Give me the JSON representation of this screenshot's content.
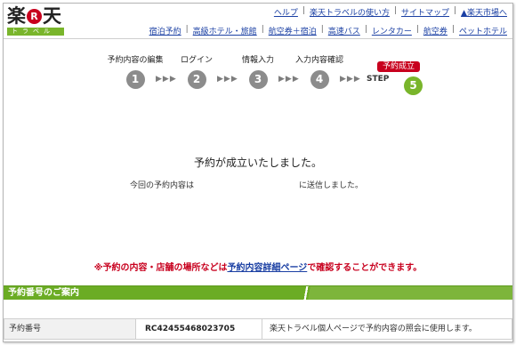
{
  "header": {
    "logo_kanji_left": "楽",
    "logo_r": "R",
    "logo_kanji_right": "天",
    "logo_sub": "トラベル",
    "top_links": [
      "ヘルプ",
      "楽天トラベルの使い方",
      "サイトマップ",
      "▲楽天市場へ"
    ],
    "nav_links": [
      "宿泊予約",
      "高級ホテル・旅館",
      "航空券＋宿泊",
      "高速バス",
      "レンタカー",
      "航空券",
      "ペットホテル"
    ]
  },
  "steps": {
    "items": [
      {
        "label": "予約内容の編集",
        "number": "1"
      },
      {
        "label": "ログイン",
        "number": "2"
      },
      {
        "label": "情報入力",
        "number": "3"
      },
      {
        "label": "入力内容確認",
        "number": "4"
      },
      {
        "label": "予約成立",
        "number": "5"
      }
    ],
    "step_word": "STEP",
    "arrow": "▶▶▶"
  },
  "main": {
    "done_message": "予約が成立いたしました。",
    "sent_prefix": "今回の予約内容は",
    "sent_suffix": "に送信しました。",
    "notice_prefix": "※予約の内容・店舗の場所などは",
    "notice_link": "予約内容詳細ページ",
    "notice_suffix": "で確認することができます。"
  },
  "reservation": {
    "section_title": "予約番号のご案内",
    "label": "予約番号",
    "number": "RC42455468023705",
    "note": "楽天トラベル個人ページで予約内容の照会に使用します。"
  },
  "colors": {
    "accent_red": "#c8001e",
    "accent_green": "#79b52b",
    "link_blue": "#1a3fa3"
  }
}
